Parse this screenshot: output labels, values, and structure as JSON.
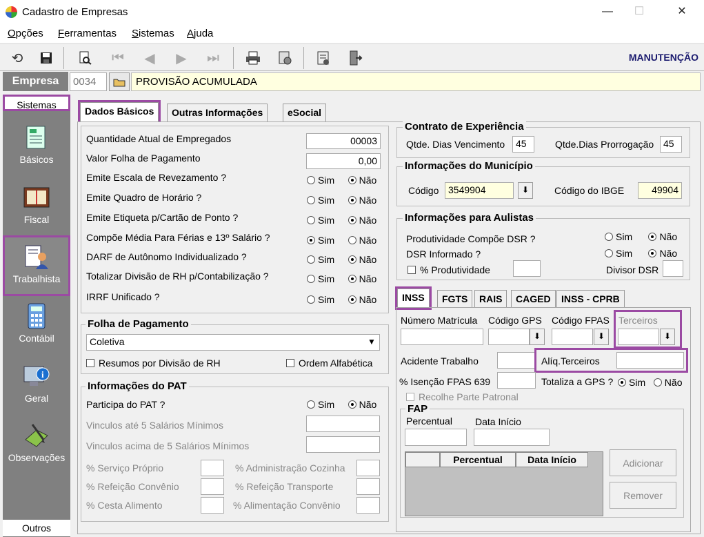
{
  "window": {
    "title": "Cadastro de Empresas",
    "minimize": "—",
    "maximize": "☐",
    "close": "✕"
  },
  "menu": [
    {
      "label": "Opções",
      "ul": "O",
      "rest": "pções"
    },
    {
      "label": "Ferramentas",
      "ul": "F",
      "rest": "erramentas"
    },
    {
      "label": "Sistemas",
      "ul": "S",
      "rest": "istemas"
    },
    {
      "label": "Ajuda",
      "ul": "A",
      "rest": "juda"
    }
  ],
  "toolbar": {
    "mode": "MANUTENÇÃO"
  },
  "empresa": {
    "label": "Empresa",
    "code": "0034",
    "name": "PROVISÃO ACUMULADA"
  },
  "sidebar": {
    "header": "Sistemas",
    "items": [
      {
        "label": "Básicos",
        "icon": "basicos-icon"
      },
      {
        "label": "Fiscal",
        "icon": "fiscal-icon"
      },
      {
        "label": "Trabalhista",
        "icon": "trabalhista-icon"
      },
      {
        "label": "Contábil",
        "icon": "contabil-icon"
      },
      {
        "label": "Geral",
        "icon": "geral-icon"
      },
      {
        "label": "Observações",
        "icon": "observacoes-icon"
      }
    ],
    "footer": "Outros"
  },
  "tabs": [
    "Dados Básicos",
    "Outras Informações",
    "eSocial"
  ],
  "dados": {
    "qtd_empregados_label": "Quantidade Atual de Empregados",
    "qtd_empregados": "00003",
    "valor_folha_label": "Valor Folha de Pagamento",
    "valor_folha": "0,00",
    "sim": "Sim",
    "nao": "Não",
    "questions": [
      {
        "label": "Emite Escala de Revezamento ?",
        "value": "Não"
      },
      {
        "label": "Emite Quadro de Horário ?",
        "value": "Não"
      },
      {
        "label": "Emite Etiqueta p/Cartão de Ponto ?",
        "value": "Não"
      },
      {
        "label": "Compõe Média Para Férias e 13º Salário ?",
        "value": "Sim"
      },
      {
        "label": "DARF de Autônomo Individualizado ?",
        "value": "Não"
      },
      {
        "label": "Totalizar Divisão de RH p/Contabilização ?",
        "value": "Não"
      },
      {
        "label": "IRRF Unificado ?",
        "value": "Não"
      }
    ]
  },
  "folha": {
    "title": "Folha de Pagamento",
    "selected": "Coletiva",
    "resumos_label": "Resumos por Divisão de RH",
    "ordem_label": "Ordem Alfabética"
  },
  "pat": {
    "title": "Informações do PAT",
    "participa_label": "Participa do PAT ?",
    "participa_value": "Não",
    "vinc5_label": "Vinculos até 5 Salários Mínimos",
    "vinc5a_label": "Vinculos acima de 5 Salários Mínimos",
    "servico_proprio": "% Serviço Próprio",
    "adm_cozinha": "% Administração Cozinha",
    "ref_convenio": "% Refeição Convênio",
    "ref_transporte": "% Refeição Transporte",
    "cesta": "% Cesta Alimento",
    "alim_convenio": "% Alimentação Convênio"
  },
  "contrato": {
    "title": "Contrato de Experiência",
    "venc_label": "Qtde. Dias Vencimento",
    "venc": "45",
    "prorrog_label": "Qtde.Dias Prorrogação",
    "prorrog": "45"
  },
  "municipio": {
    "title": "Informações do Município",
    "codigo_label": "Código",
    "codigo": "3549904",
    "ibge_label": "Código do IBGE",
    "ibge": "49904"
  },
  "aulistas": {
    "title": "Informações para Aulistas",
    "prod_dsr_label": "Produtividade Compõe DSR ?",
    "prod_dsr_value": "Não",
    "dsr_inf_label": "DSR Informado ?",
    "dsr_inf_value": "Não",
    "perc_prod_label": "% Produtividade",
    "divisor_label": "Divisor DSR"
  },
  "subtabs": [
    "INSS",
    "FGTS",
    "RAIS",
    "CAGED",
    "INSS - CPRB"
  ],
  "inss": {
    "matricula_label": "Número Matrícula",
    "gps_label": "Código GPS",
    "fpas_label": "Código FPAS",
    "terceiros_label": "Terceiros",
    "acidente_label": "Acidente Trabalho",
    "aliq_terceiros_label": "Alíq.Terceiros",
    "isencao_label": "% Isenção FPAS 639",
    "totaliza_label": "Totaliza a GPS ?",
    "totaliza_value": "Sim",
    "recolhe_label": "Recolhe Parte Patronal"
  },
  "fap": {
    "title": "FAP",
    "percentual_label": "Percentual",
    "data_label": "Data Início",
    "columns": [
      "Percentual",
      "Data Início"
    ],
    "add_button": "Adicionar",
    "remove_button": "Remover"
  }
}
